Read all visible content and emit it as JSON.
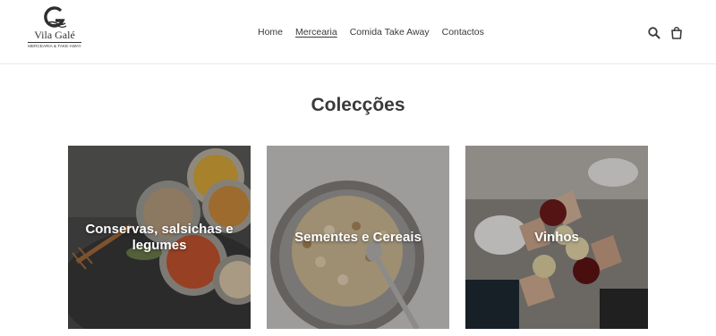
{
  "header": {
    "logo": {
      "name": "Vila Galé",
      "tagline": "MERCEARIA & TAKE-AWAY"
    },
    "nav": [
      {
        "label": "Home",
        "active": false
      },
      {
        "label": "Mercearia",
        "active": true
      },
      {
        "label": "Comida Take Away",
        "active": false
      },
      {
        "label": "Contactos",
        "active": false
      }
    ],
    "icons": {
      "search": "search-icon",
      "cart": "cart-icon"
    }
  },
  "main": {
    "title": "Colecções",
    "collections": [
      {
        "label": "Conservas, salsichas e legumes",
        "image": "canned-food-photo"
      },
      {
        "label": "Sementes e Cereais",
        "image": "granola-bowl-photo"
      },
      {
        "label": "Vinhos",
        "image": "wine-toast-photo"
      }
    ]
  },
  "colors": {
    "text": "#3a3a3a",
    "border": "#ebebeb",
    "overlay_text": "#ffffff"
  }
}
